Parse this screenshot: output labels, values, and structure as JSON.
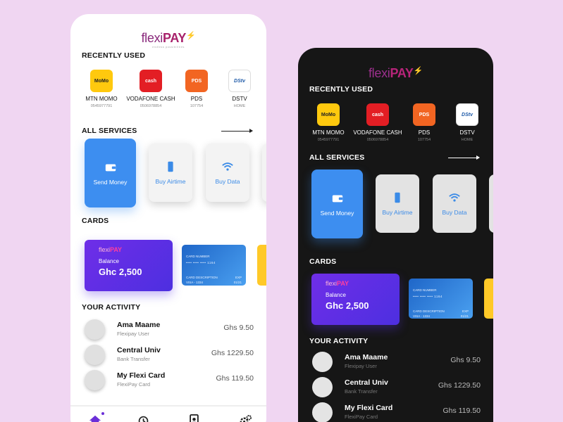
{
  "brand": {
    "name_a": "flexi",
    "name_b": "PAY",
    "tagline": "endless possibilities"
  },
  "sections": {
    "recent": "RECENTLY USED",
    "services": "ALL SERVICES",
    "cards": "CARDS",
    "activity": "YOUR ACTIVITY"
  },
  "recent": [
    {
      "name": "MTN MOMO",
      "sub": "0545977791",
      "icon": "mtn-momo-icon",
      "glyph": "MoMo"
    },
    {
      "name": "VODAFONE CASH",
      "sub": "0506978854",
      "icon": "vodafone-cash-icon",
      "glyph": "cash"
    },
    {
      "name": "PDS",
      "sub": "107754",
      "icon": "pds-icon",
      "glyph": "PDS"
    },
    {
      "name": "DSTV",
      "sub": "HOME",
      "icon": "dstv-icon",
      "glyph": "DStv"
    }
  ],
  "services": [
    {
      "label": "Send Money",
      "icon": "wallet-icon"
    },
    {
      "label": "Buy Airtime",
      "icon": "phone-icon"
    },
    {
      "label": "Buy Data",
      "icon": "wifi-icon"
    }
  ],
  "card_main": {
    "logo_a": "flexi",
    "logo_b": "PAY",
    "balance_label": "Balance",
    "balance_value": "Ghc 2,500"
  },
  "card_blue": {
    "number_label": "CARD NUMBER",
    "number_value": "•••• •••• •••• 1164",
    "desc_label": "CARD DESCRIPTION",
    "desc_value": "VISA - 1334",
    "exp_label": "EXP",
    "exp_value": "01/21"
  },
  "activity": [
    {
      "name": "Ama Maame",
      "sub": "Flexipay User",
      "amount": "Ghs 9.50"
    },
    {
      "name": "Central Univ",
      "sub": "Bank Transfer",
      "amount": "Ghs 1229.50"
    },
    {
      "name": "My Flexi Card",
      "sub": "FlexiPay Card",
      "amount": "Ghs 119.50"
    }
  ],
  "nav": [
    "home-icon",
    "history-icon",
    "contacts-icon",
    "settings-icon"
  ],
  "colors": {
    "accent_blue": "#3d8ef0",
    "purple": "#6f2ee8",
    "yellow": "#ffc928",
    "dark_bg": "#161616"
  }
}
